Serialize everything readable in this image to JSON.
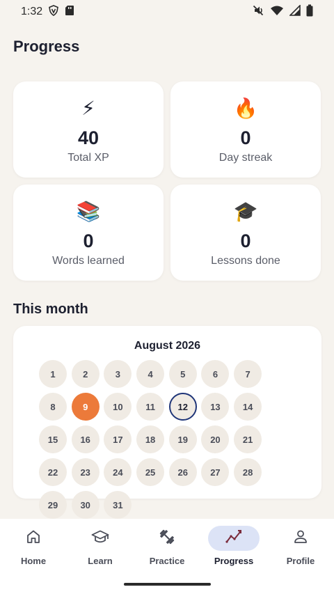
{
  "status_bar": {
    "time": "1:32",
    "left_icons": [
      "shield-v-icon",
      "sd-card-icon"
    ],
    "right_icons": [
      "mute-icon",
      "wifi-icon",
      "signal-icon",
      "battery-icon"
    ]
  },
  "page": {
    "title": "Progress"
  },
  "stats": [
    {
      "emoji": "⚡",
      "value": "40",
      "label": "Total XP"
    },
    {
      "emoji": "🔥",
      "value": "0",
      "label": "Day streak"
    },
    {
      "emoji": "📚",
      "value": "0",
      "label": "Words learned"
    },
    {
      "emoji": "🎓",
      "value": "0",
      "label": "Lessons done"
    }
  ],
  "calendar": {
    "section_title": "This month",
    "month": "August 2026",
    "days": [
      "1",
      "2",
      "3",
      "4",
      "5",
      "6",
      "7",
      "8",
      "9",
      "10",
      "11",
      "12",
      "13",
      "14",
      "15",
      "16",
      "17",
      "18",
      "19",
      "20",
      "21",
      "22",
      "23",
      "24",
      "25",
      "26",
      "27",
      "28",
      "29",
      "30",
      "31"
    ],
    "active_day": "9",
    "today": "12",
    "colors": {
      "active": "#ec7a3a",
      "today_ring": "#1f3578"
    }
  },
  "bottom_nav": {
    "items": [
      {
        "label": "Home",
        "icon": "home-icon"
      },
      {
        "label": "Learn",
        "icon": "graduation-cap-icon"
      },
      {
        "label": "Practice",
        "icon": "dumbbell-icon"
      },
      {
        "label": "Progress",
        "icon": "chart-line-icon"
      },
      {
        "label": "Profile",
        "icon": "person-icon"
      }
    ],
    "selected": "Progress"
  }
}
